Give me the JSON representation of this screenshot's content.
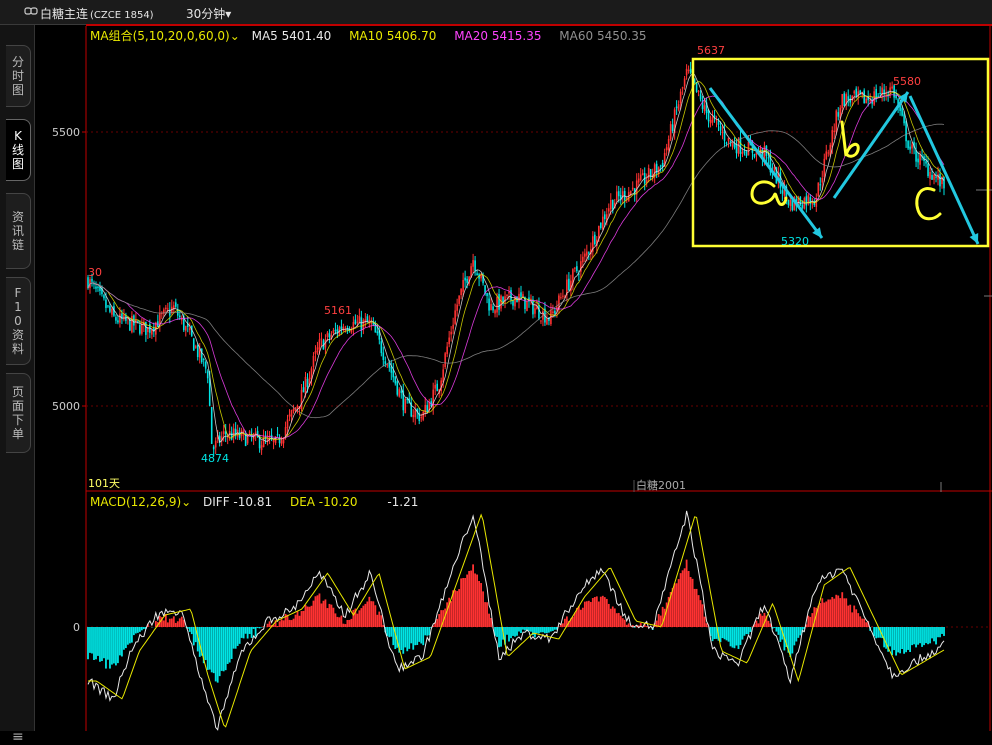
{
  "header": {
    "symbol": "白糖主连",
    "code": "(CZCE 1854)",
    "period": "30分钟",
    "period_caret": "▾"
  },
  "sidebar": {
    "tabs": [
      {
        "label": "分时图",
        "active": false
      },
      {
        "label": "K线图",
        "active": true
      },
      {
        "label": "资讯链",
        "active": false
      },
      {
        "label": "F10资料",
        "active": false
      },
      {
        "label": "页面下单",
        "active": false
      }
    ],
    "menu_icon": "≡"
  },
  "ma_legend": {
    "combo": "MA组合(5,10,20,0,60,0)",
    "ma5": "MA5 5401.40",
    "ma10": "MA10 5406.70",
    "ma20": "MA20 5415.35",
    "ma60": "MA60 5450.35"
  },
  "macd_legend": {
    "name": "MACD(12,26,9)",
    "diff": "DIFF -10.81",
    "dea": "DEA -10.20",
    "macd": "-1.21"
  },
  "colors": {
    "up": "#ff3232",
    "down": "#00e5e5",
    "ma5": "#e8e8e8",
    "ma10": "#e8e800",
    "ma20": "#ff44ff",
    "ma60": "#909090",
    "annotation_box": "#ffff33",
    "arrow": "#22c8e0",
    "axis": "#c00000"
  },
  "chart_data": {
    "type": "candlestick",
    "price_axis": {
      "ticks": [
        5000,
        5500
      ],
      "range": [
        4790,
        5720
      ]
    },
    "macd_axis": {
      "ticks": [
        0
      ]
    },
    "annotations": {
      "peak_left": "5637",
      "peak_right": "5580",
      "low_mid": "5161",
      "low_bottom": "4874",
      "low_box": "5320",
      "left_edge": "30",
      "days": "101天",
      "contract": "白糖2001"
    },
    "handwritten": [
      "a",
      "b",
      "c"
    ],
    "price_path": [
      [
        0,
        5230
      ],
      [
        0.03,
        5160
      ],
      [
        0.07,
        5140
      ],
      [
        0.1,
        5180
      ],
      [
        0.12,
        5125
      ],
      [
        0.14,
        5060
      ],
      [
        0.145,
        4920
      ],
      [
        0.16,
        4950
      ],
      [
        0.19,
        4940
      ],
      [
        0.22,
        4930
      ],
      [
        0.25,
        5020
      ],
      [
        0.27,
        5110
      ],
      [
        0.3,
        5150
      ],
      [
        0.33,
        5150
      ],
      [
        0.35,
        5080
      ],
      [
        0.37,
        5000
      ],
      [
        0.39,
        4980
      ],
      [
        0.41,
        5040
      ],
      [
        0.43,
        5180
      ],
      [
        0.45,
        5270
      ],
      [
        0.47,
        5180
      ],
      [
        0.5,
        5200
      ],
      [
        0.54,
        5160
      ],
      [
        0.56,
        5220
      ],
      [
        0.58,
        5270
      ],
      [
        0.61,
        5370
      ],
      [
        0.64,
        5400
      ],
      [
        0.67,
        5440
      ],
      [
        0.7,
        5610
      ],
      [
        0.72,
        5540
      ],
      [
        0.75,
        5480
      ],
      [
        0.79,
        5460
      ],
      [
        0.82,
        5370
      ],
      [
        0.85,
        5380
      ],
      [
        0.88,
        5560
      ],
      [
        0.91,
        5560
      ],
      [
        0.94,
        5580
      ],
      [
        0.96,
        5470
      ],
      [
        1,
        5400
      ]
    ],
    "macd_path": [
      [
        0,
        -45
      ],
      [
        0.03,
        -60
      ],
      [
        0.05,
        -20
      ],
      [
        0.08,
        10
      ],
      [
        0.11,
        15
      ],
      [
        0.13,
        -40
      ],
      [
        0.15,
        -85
      ],
      [
        0.18,
        -20
      ],
      [
        0.21,
        5
      ],
      [
        0.24,
        15
      ],
      [
        0.27,
        45
      ],
      [
        0.3,
        10
      ],
      [
        0.33,
        45
      ],
      [
        0.36,
        -35
      ],
      [
        0.39,
        -25
      ],
      [
        0.42,
        35
      ],
      [
        0.45,
        95
      ],
      [
        0.48,
        -25
      ],
      [
        0.51,
        -5
      ],
      [
        0.54,
        -10
      ],
      [
        0.57,
        25
      ],
      [
        0.6,
        50
      ],
      [
        0.63,
        5
      ],
      [
        0.66,
        0
      ],
      [
        0.7,
        95
      ],
      [
        0.73,
        -20
      ],
      [
        0.76,
        -30
      ],
      [
        0.79,
        20
      ],
      [
        0.82,
        -45
      ],
      [
        0.85,
        35
      ],
      [
        0.88,
        50
      ],
      [
        0.91,
        5
      ],
      [
        0.94,
        -40
      ],
      [
        1,
        -15
      ]
    ]
  }
}
